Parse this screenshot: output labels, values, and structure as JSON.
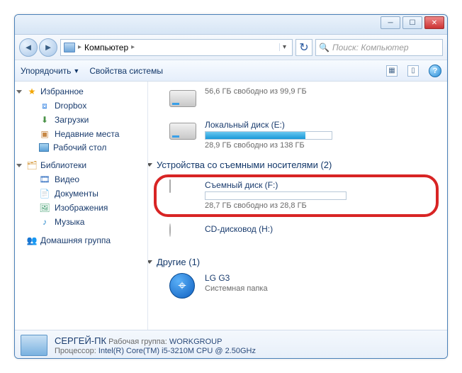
{
  "window": {
    "title": "Компьютер"
  },
  "navbar": {
    "location": "Компьютер",
    "arrow": "▸",
    "search_placeholder": "Поиск: Компьютер"
  },
  "toolbar": {
    "organize": "Упорядочить",
    "system_props": "Свойства системы"
  },
  "sidebar": {
    "favorites": "Избранное",
    "fav_items": [
      {
        "icon": "dropbox",
        "label": "Dropbox"
      },
      {
        "icon": "downloads",
        "label": "Загрузки"
      },
      {
        "icon": "recent",
        "label": "Недавние места"
      },
      {
        "icon": "desktop",
        "label": "Рабочий стол"
      }
    ],
    "libraries": "Библиотеки",
    "lib_items": [
      {
        "icon": "video",
        "label": "Видео"
      },
      {
        "icon": "docs",
        "label": "Документы"
      },
      {
        "icon": "images",
        "label": "Изображения"
      },
      {
        "icon": "music",
        "label": "Музыка"
      }
    ],
    "homegroup": "Домашняя группа"
  },
  "content": {
    "drive1_free": "56,6 ГБ свободно из 99,9 ГБ",
    "drive2_name": "Локальный диск (E:)",
    "drive2_free": "28,9 ГБ свободно из 138 ГБ",
    "removable_header": "Устройства со съемными носителями (2)",
    "drive_f_name": "Съемный диск (F:)",
    "drive_f_free": "28,7 ГБ свободно из 28,8 ГБ",
    "drive_cd_name": "CD-дисковод (H:)",
    "other_header": "Другие (1)",
    "lg_name": "LG G3",
    "lg_sub": "Системная папка"
  },
  "details": {
    "computer_name": "СЕРГЕЙ-ПК",
    "workgroup_label": "Рабочая группа:",
    "workgroup_value": "WORKGROUP",
    "cpu_label": "Процессор:",
    "cpu_value": "Intel(R) Core(TM) i5-3210M CPU @ 2.50GHz"
  }
}
